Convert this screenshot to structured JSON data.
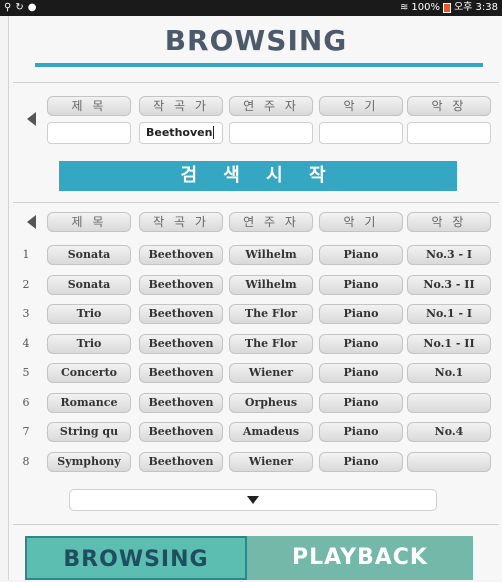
{
  "status": {
    "left_icons": [
      "usb-icon",
      "sync-icon",
      "notification-icon"
    ],
    "wifi": "wifi-icon",
    "battery_percent": "100%",
    "time": "오후 3:38"
  },
  "title": "BROWSING",
  "search": {
    "headers": [
      "제 목",
      "작 곡 가",
      "연 주 자",
      "악 기",
      "악 장"
    ],
    "fields": [
      "",
      "Beethoven",
      "",
      "",
      ""
    ],
    "button": "검 색 시 작"
  },
  "results": {
    "headers": [
      "제 목",
      "작 곡 가",
      "연 주 자",
      "악 기",
      "악 장"
    ],
    "rows": [
      {
        "num": "1",
        "title": "Sonata",
        "composer": "Beethoven",
        "performer": "Wilhelm",
        "instrument": "Piano",
        "movement": "No.3 - I"
      },
      {
        "num": "2",
        "title": "Sonata",
        "composer": "Beethoven",
        "performer": "Wilhelm",
        "instrument": "Piano",
        "movement": "No.3 - II"
      },
      {
        "num": "3",
        "title": "Trio",
        "composer": "Beethoven",
        "performer": "The Flor",
        "instrument": "Piano",
        "movement": "No.1 - I"
      },
      {
        "num": "4",
        "title": "Trio",
        "composer": "Beethoven",
        "performer": "The Flor",
        "instrument": "Piano",
        "movement": "No.1 - II"
      },
      {
        "num": "5",
        "title": "Concerto",
        "composer": "Beethoven",
        "performer": "Wiener",
        "instrument": "Piano",
        "movement": "No.1"
      },
      {
        "num": "6",
        "title": "Romance",
        "composer": "Beethoven",
        "performer": "Orpheus",
        "instrument": "Piano",
        "movement": ""
      },
      {
        "num": "7",
        "title": "String qu",
        "composer": "Beethoven",
        "performer": "Amadeus",
        "instrument": "Piano",
        "movement": "No.4"
      },
      {
        "num": "8",
        "title": "Symphony",
        "composer": "Beethoven",
        "performer": "Wiener",
        "instrument": "Piano",
        "movement": ""
      }
    ]
  },
  "tabs": {
    "browsing": "BROWSING",
    "playback": "PLAYBACK"
  },
  "colors": {
    "accent": "#36a7c2",
    "tab_active": "#5cbdb1",
    "tab_inactive": "#73b8a8"
  }
}
